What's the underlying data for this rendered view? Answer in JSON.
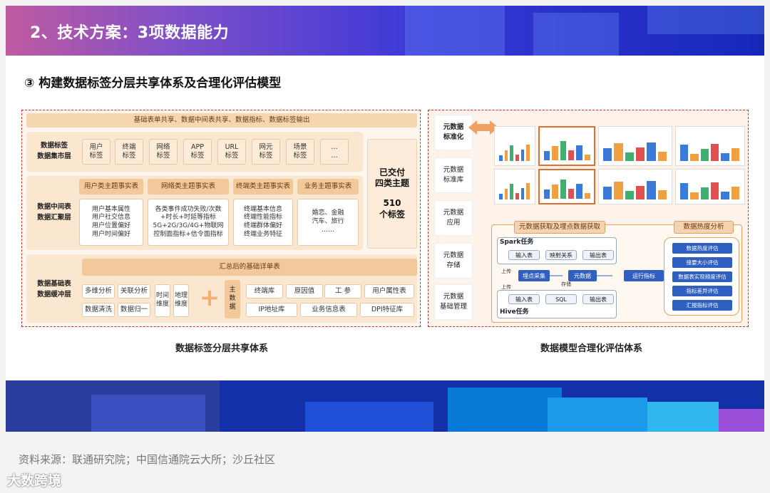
{
  "title": "2、技术方案：3项数据能力",
  "subtitle": "③ 构建数据标签分层共享体系及合理化评估模型",
  "left": {
    "top_bar": "基础表单共享、数据中间表共享、数据指标、数据标签输出",
    "layer1_label": "数据标签\n数据集市层",
    "tags": [
      "用户\n标签",
      "终端\n标签",
      "网络\n标签",
      "APP\n标签",
      "URL\n标签",
      "网元\n标签",
      "场景\n标签",
      "…\n…"
    ],
    "layer2_label": "数据中间表\n数据汇聚层",
    "topics": [
      {
        "head": "用户类主题事实表",
        "body": "用户基本属性\n用户社交信息\n用户位置偏好\n用户时间偏好"
      },
      {
        "head": "网络类主题事实表",
        "body": "各类事件成功失败/次数\n+时长+时延等指标\n5G+2G/3G/4G+物联网\n控制面指标+信令面指标"
      },
      {
        "head": "终端类主题事实表",
        "body": "终端基本信息\n终端性能指标\n终端群体偏好\n终端业务特征"
      },
      {
        "head": "业务主题事实表",
        "body": "婚恋、金融\n汽车、旅行\n……"
      }
    ],
    "side_box": {
      "line1": "已交付",
      "line2": "四类主题",
      "line3": "510",
      "line4": "个标签"
    },
    "layer3_label": "数据基础表\n数据缓冲层",
    "summary_bar": "汇总后的基础详单表",
    "tools": [
      "多维分析",
      "关联分析",
      "数据清洗",
      "数据归一"
    ],
    "dims": [
      "时间\n维度",
      "地理\n维度"
    ],
    "plus": "+",
    "main_data": "主\n数\n据",
    "libs": [
      "终端库",
      "原因值",
      "工 参",
      "用户属性表",
      "IP地址库",
      "业务信息表",
      "DPI特征库"
    ],
    "caption": "数据标签分层共享体系"
  },
  "right": {
    "side_items": [
      "元数据\n标准化",
      "元数据\n标准库",
      "元数据\n应用",
      "元数据\n存储",
      "元数据\n基础管理"
    ],
    "meta_title": "元数据获取及埋点数据获取",
    "spark": "Spark任务",
    "hive": "Hive任务",
    "spark_items": [
      "输入表",
      "映射关系",
      "输出表"
    ],
    "hive_items": [
      "输入表",
      "SQL",
      "输出表"
    ],
    "flow": [
      "埋点采集",
      "元数据",
      "运行指标"
    ],
    "small": [
      "上传",
      "上传",
      "存储"
    ],
    "heat_title": "数据热度分析",
    "heat_items": [
      "数据热度评估",
      "接要大小评估",
      "数据表实现频度评估",
      "指标差异评估",
      "汇报指标评估"
    ],
    "caption": "数据模型合理化评估体系"
  },
  "source": "资料来源：联通研究院；中国信通院云大所；沙丘社区",
  "watermark": "大数跨境"
}
